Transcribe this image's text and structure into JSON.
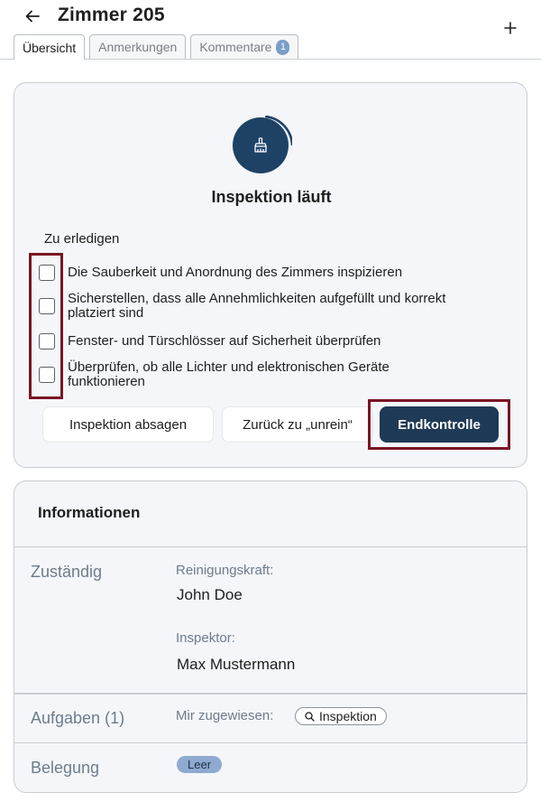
{
  "header": {
    "title": "Zimmer 205",
    "back_icon": "arrow-left-icon",
    "add_icon": "plus-icon"
  },
  "tabs": [
    {
      "label": "Übersicht",
      "active": true
    },
    {
      "label": "Anmerkungen",
      "active": false
    },
    {
      "label": "Kommentare",
      "active": false,
      "badge": "1"
    }
  ],
  "inspection": {
    "status_icon": "broom-icon",
    "status_text": "Inspektion läuft",
    "todo_heading": "Zu erledigen",
    "tasks": [
      {
        "label": "Die Sauberkeit und Anordnung des Zimmers inspizieren",
        "checked": false
      },
      {
        "label": "Sicherstellen, dass alle Annehmlichkeiten aufgefüllt und korrekt platziert sind",
        "checked": false
      },
      {
        "label": "Fenster- und Türschlösser auf Sicherheit überprüfen",
        "checked": false
      },
      {
        "label": "Überprüfen, ob alle Lichter und elektronischen Geräte funktionieren",
        "checked": false
      }
    ],
    "buttons": {
      "cancel": "Inspektion absagen",
      "back_unclean": "Zurück zu „unrein“",
      "final_check": "Endkontrolle"
    },
    "colors": {
      "primary": "#1e3a56",
      "highlight": "#7a1524"
    }
  },
  "info": {
    "heading": "Informationen",
    "responsible": {
      "label": "Zuständig",
      "cleaner_label": "Reinigungskraft:",
      "cleaner_name": "John Doe",
      "inspector_label": "Inspektor:",
      "inspector_name": "Max Mustermann"
    },
    "tasks_row": {
      "label": "Aufgaben (1)",
      "assigned_label": "Mir zugewiesen:",
      "chip_icon": "search-icon",
      "chip_label": "Inspektion"
    },
    "occupancy": {
      "label": "Belegung",
      "value": "Leer"
    }
  }
}
